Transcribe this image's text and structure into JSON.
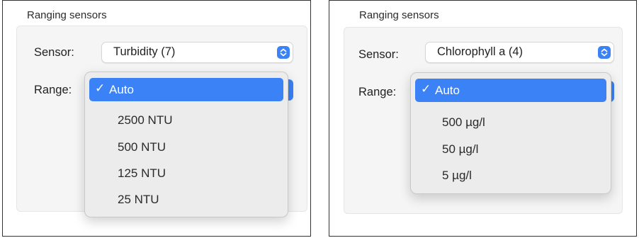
{
  "left_panel": {
    "section_title": "Ranging sensors",
    "sensor_label": "Sensor:",
    "sensor_value": "Turbidity (7)",
    "range_label": "Range:",
    "menu_items": [
      "Auto",
      "2500 NTU",
      "500 NTU",
      "125 NTU",
      "25 NTU"
    ],
    "selected_index": 0
  },
  "right_panel": {
    "section_title": "Ranging sensors",
    "sensor_label": "Sensor:",
    "sensor_value": "Chlorophyll a (4)",
    "range_label": "Range:",
    "menu_items": [
      "Auto",
      "500 µg/l",
      "50 µg/l",
      "5 µg/l"
    ],
    "selected_index": 0
  },
  "colors": {
    "accent": "#3b82f6",
    "menu_bg": "#ececec",
    "group_bg": "#f5f5f5"
  },
  "icons": {
    "checkmark": "✓",
    "popup_stepper": "chevron-up-down-icon"
  }
}
